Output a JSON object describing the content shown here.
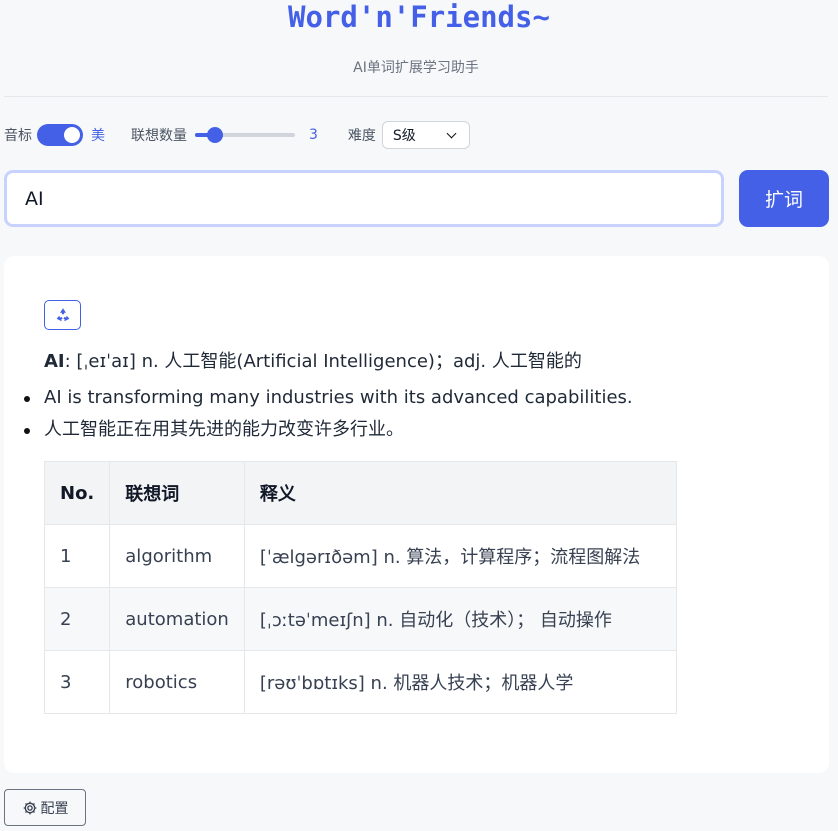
{
  "header": {
    "title": "Word'n'Friends~",
    "subtitle": "AI单词扩展学习助手"
  },
  "controls": {
    "phonetic_label": "音标",
    "phonetic_option": "美",
    "phonetic_on": true,
    "count_label": "联想数量",
    "count_value": "3",
    "count_fraction": 0.2,
    "difficulty_label": "难度",
    "difficulty_value": "S级"
  },
  "search": {
    "value": "AI",
    "button_label": "扩词"
  },
  "result": {
    "word": "AI",
    "definition": ": [ˌeɪˈaɪ] n. 人工智能(Artificial Intelligence)；adj. 人工智能的",
    "examples": [
      "AI is transforming many industries with its advanced capabilities.",
      "人工智能正在用其先进的能力改变许多行业。"
    ],
    "table": {
      "headers": [
        "No.",
        "联想词",
        "释义"
      ],
      "rows": [
        [
          "1",
          "algorithm",
          "[ˈælgərɪðəm] n. 算法，计算程序；流程图解法"
        ],
        [
          "2",
          "automation",
          "[ˌɔːtəˈmeɪʃn] n. 自动化（技术）； 自动操作"
        ],
        [
          "3",
          "robotics",
          "[rəʊˈbɒtɪks] n. 机器人技术；机器人学"
        ]
      ]
    }
  },
  "footer": {
    "config_label": "配置"
  },
  "colors": {
    "accent": "#4460e6",
    "background": "#f7f8fa"
  },
  "icons": {
    "refresh": "recycle-icon",
    "config": "gear-icon"
  }
}
